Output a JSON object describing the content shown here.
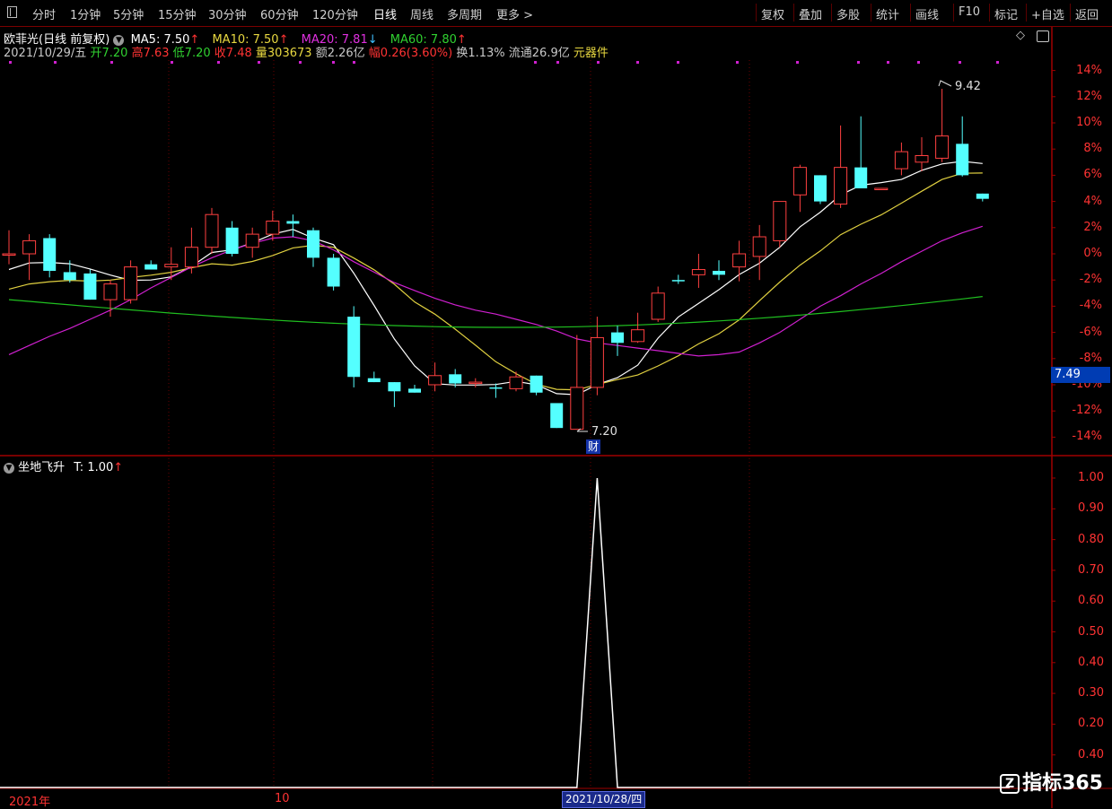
{
  "toolbar": {
    "left": [
      "分时",
      "1分钟",
      "5分钟",
      "15分钟",
      "30分钟",
      "60分钟",
      "120分钟",
      "日线",
      "周线",
      "多周期",
      "更多 >"
    ],
    "active": "日线",
    "right": [
      "复权",
      "叠加",
      "多股",
      "统计",
      "画线",
      "F10",
      "标记",
      "+自选",
      "返回"
    ]
  },
  "stock": {
    "name": "欧菲光(日线 前复权)",
    "ma5": "MA5: 7.50",
    "ma10": "MA10: 7.50",
    "ma20": "MA20: 7.81",
    "ma60": "MA60: 7.80",
    "date": "2021/10/29/五",
    "open_label": "开",
    "open": "7.20",
    "high_label": "高",
    "high": "7.63",
    "low_label": "低",
    "low": "7.20",
    "close_label": "收",
    "close": "7.48",
    "vol_label": "量",
    "vol": "303673",
    "amount": "额2.26亿",
    "range_label": "幅",
    "range": "0.26(3.60%)",
    "turnover": "换1.13%",
    "float": "流通26.9亿",
    "sector": "元器件",
    "price_tag": "7.49",
    "high_mark": "9.42",
    "low_mark": "7.20",
    "fin_tag": "财"
  },
  "indicator": {
    "name": "坐地飞升",
    "value": "T: 1.00"
  },
  "x_axis": {
    "year": "2021年",
    "month": "10",
    "cursor_date": "2021/10/28/四"
  },
  "watermark": "指标365",
  "chart_data": [
    {
      "type": "candlestick",
      "y_axis_labels": [
        "14%",
        "12%",
        "10%",
        "8%",
        "6%",
        "4%",
        "2%",
        "0%",
        "-2%",
        "-4%",
        "-6%",
        "-8%",
        "-10%",
        "-12%",
        "-14%"
      ],
      "ylim": [
        -14,
        14
      ],
      "unit": "% change (percentage axis relative to reference price)",
      "series": [
        {
          "name": "MA5",
          "color": "#ffffff"
        },
        {
          "name": "MA10",
          "color": "#e0d040"
        },
        {
          "name": "MA20",
          "color": "#d020d0"
        },
        {
          "name": "MA60",
          "color": "#20c020"
        }
      ],
      "candles_pct": [
        [
          0.0,
          1.8,
          -0.8,
          0.0
        ],
        [
          0.0,
          1.5,
          -2.0,
          1.0
        ],
        [
          1.2,
          1.5,
          -1.8,
          -1.3
        ],
        [
          -1.4,
          -0.5,
          -2.2,
          -2.0
        ],
        [
          -1.5,
          -1.2,
          -3.5,
          -3.5
        ],
        [
          -3.5,
          -2.0,
          -4.8,
          -2.3
        ],
        [
          -3.5,
          -0.5,
          -3.8,
          -1.0
        ],
        [
          -0.8,
          -0.5,
          -1.2,
          -1.2
        ],
        [
          -1.0,
          0.5,
          -2.0,
          -0.8
        ],
        [
          -1.0,
          2.0,
          -1.5,
          0.5
        ],
        [
          0.5,
          3.5,
          0.0,
          3.0
        ],
        [
          2.0,
          2.5,
          -0.2,
          0.0
        ],
        [
          0.5,
          2.0,
          -0.3,
          1.5
        ],
        [
          1.5,
          3.3,
          1.0,
          2.5
        ],
        [
          2.5,
          3.0,
          1.3,
          2.3
        ],
        [
          1.8,
          2.0,
          -1.0,
          -0.3
        ],
        [
          -0.3,
          0.0,
          -2.8,
          -2.5
        ],
        [
          -4.8,
          -4.0,
          -10.2,
          -9.4
        ],
        [
          -9.5,
          -9.0,
          -9.8,
          -9.8
        ],
        [
          -9.8,
          -9.8,
          -11.7,
          -10.5
        ],
        [
          -10.3,
          -10.0,
          -10.6,
          -10.6
        ],
        [
          -10.0,
          -8.3,
          -10.5,
          -9.3
        ],
        [
          -9.2,
          -8.8,
          -10.2,
          -9.9
        ],
        [
          -9.9,
          -9.5,
          -10.2,
          -9.8
        ],
        [
          -10.2,
          -9.9,
          -11.0,
          -10.3
        ],
        [
          -10.3,
          -9.0,
          -10.5,
          -9.4
        ],
        [
          -9.3,
          -9.3,
          -10.8,
          -10.6
        ],
        [
          -11.4,
          -11.6,
          -13.3,
          -13.3
        ],
        [
          -13.4,
          -6.2,
          -13.4,
          -10.2
        ],
        [
          -10.2,
          -4.8,
          -10.8,
          -6.4
        ],
        [
          -6.0,
          -5.5,
          -7.8,
          -6.8
        ],
        [
          -6.7,
          -4.5,
          -6.8,
          -5.8
        ],
        [
          -5.0,
          -2.5,
          -5.2,
          -3.0
        ],
        [
          -2.0,
          -1.6,
          -2.3,
          -2.1
        ],
        [
          -1.6,
          0.0,
          -2.6,
          -1.2
        ],
        [
          -1.3,
          -0.5,
          -2.0,
          -1.6
        ],
        [
          -1.0,
          1.0,
          -2.1,
          0.0
        ],
        [
          -0.2,
          2.2,
          -2.0,
          1.3
        ],
        [
          1.0,
          3.9,
          0.5,
          4.0
        ],
        [
          4.5,
          6.8,
          3.2,
          6.6
        ],
        [
          6.0,
          6.0,
          3.8,
          4.0
        ],
        [
          3.8,
          9.8,
          3.5,
          6.6
        ],
        [
          6.6,
          10.5,
          5.3,
          5.0
        ],
        [
          5.0,
          5.0,
          5.0,
          5.0
        ],
        [
          6.5,
          8.5,
          6.0,
          7.8
        ],
        [
          7.0,
          8.9,
          6.3,
          7.5
        ],
        [
          7.3,
          12.6,
          7.0,
          9.0
        ],
        [
          8.4,
          10.5,
          5.9,
          6.0
        ],
        [
          4.6,
          4.6,
          4.0,
          4.2
        ]
      ]
    },
    {
      "type": "line",
      "name": "坐地飞升",
      "y_axis_labels": [
        "1.00",
        "0.90",
        "0.80",
        "0.70",
        "0.60",
        "0.50",
        "0.40",
        "0.30",
        "0.20",
        "0.40"
      ],
      "ylim": [
        0,
        1
      ],
      "values": [
        0,
        0,
        0,
        0,
        0,
        0,
        0,
        0,
        0,
        0,
        0,
        0,
        0,
        0,
        0,
        0,
        0,
        0,
        0,
        0,
        0,
        0,
        0,
        0,
        0,
        0,
        0,
        0,
        0,
        1,
        0,
        0,
        0,
        0,
        0,
        0,
        0,
        0,
        0,
        0,
        0,
        0,
        0,
        0,
        0,
        0,
        0,
        0,
        0
      ]
    }
  ]
}
